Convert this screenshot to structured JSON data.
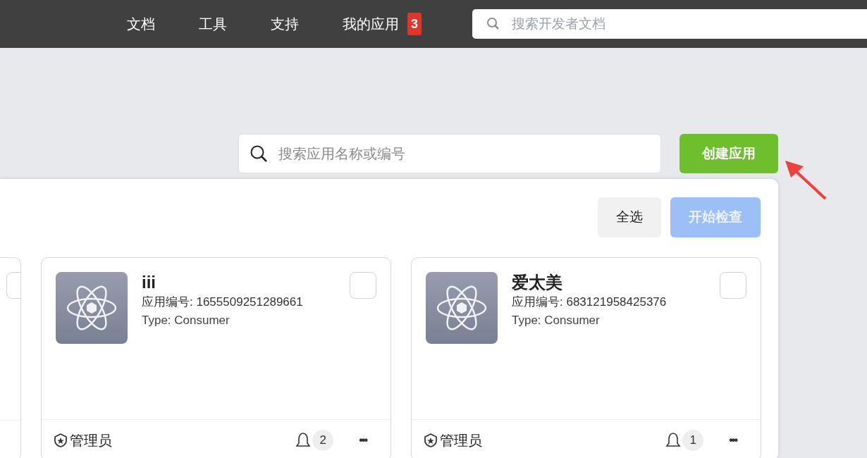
{
  "nav": {
    "items": [
      {
        "label": "文档"
      },
      {
        "label": "工具"
      },
      {
        "label": "支持"
      },
      {
        "label": "我的应用",
        "badge": "3"
      }
    ],
    "search": {
      "placeholder": "搜索开发者文档"
    }
  },
  "toolbar": {
    "search": {
      "placeholder": "搜索应用名称或编号"
    },
    "create_button": "创建应用"
  },
  "panel": {
    "buttons": [
      {
        "label": "全选",
        "disabled": false
      },
      {
        "label": "开始检查",
        "disabled": true
      }
    ],
    "apps": [
      {
        "kind": "partial",
        "checked": false
      },
      {
        "kind": "full",
        "name": "iii",
        "id_line": "应用编号: 1655509251289661",
        "type_line": "Type: Consumer",
        "checked": false,
        "role": "管理员",
        "count": "2",
        "menu": "•••"
      },
      {
        "kind": "full",
        "name": "爱太美",
        "id_line": "应用编号: 683121958425376",
        "type_line": "Type: Consumer",
        "checked": false,
        "role": "管理员",
        "count": "1",
        "menu": "•••"
      }
    ]
  }
}
